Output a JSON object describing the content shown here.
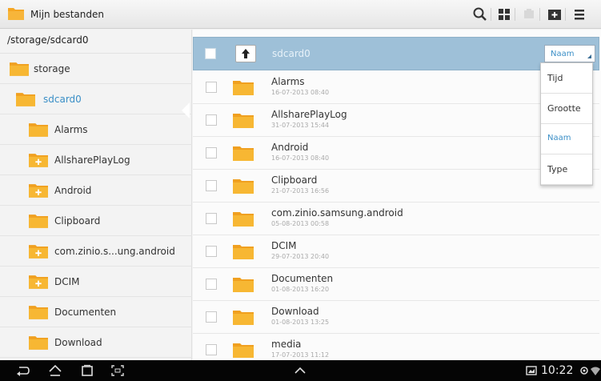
{
  "app": {
    "title": "Mijn bestanden"
  },
  "toolbar": {
    "icons": [
      "search-icon",
      "grid-view-icon",
      "disabled-icon",
      "new-folder-icon",
      "menu-icon"
    ]
  },
  "sidebar": {
    "path": "/storage/sdcard0",
    "items": [
      {
        "label": "storage",
        "level": 0,
        "plus": false
      },
      {
        "label": "sdcard0",
        "level": 1,
        "plus": false,
        "active": true
      },
      {
        "label": "Alarms",
        "level": 2,
        "plus": false
      },
      {
        "label": "AllsharePlayLog",
        "level": 2,
        "plus": true
      },
      {
        "label": "Android",
        "level": 2,
        "plus": true
      },
      {
        "label": "Clipboard",
        "level": 2,
        "plus": false
      },
      {
        "label": "com.zinio.s...ung.android",
        "level": 2,
        "plus": true
      },
      {
        "label": "DCIM",
        "level": 2,
        "plus": true
      },
      {
        "label": "Documenten",
        "level": 2,
        "plus": false
      },
      {
        "label": "Download",
        "level": 2,
        "plus": false
      }
    ]
  },
  "list": {
    "header_title": "sdcard0",
    "sort_value": "Naam",
    "rows": [
      {
        "name": "Alarms",
        "date": "16-07-2013 08:40"
      },
      {
        "name": "AllsharePlayLog",
        "date": "31-07-2013 15:44"
      },
      {
        "name": "Android",
        "date": "16-07-2013 08:40"
      },
      {
        "name": "Clipboard",
        "date": "21-07-2013 16:56"
      },
      {
        "name": "com.zinio.samsung.android",
        "date": "05-08-2013 00:58"
      },
      {
        "name": "DCIM",
        "date": "29-07-2013 20:40"
      },
      {
        "name": "Documenten",
        "date": "01-08-2013 16:20"
      },
      {
        "name": "Download",
        "date": "01-08-2013 13:25"
      },
      {
        "name": "media",
        "date": "17-07-2013 11:12"
      }
    ]
  },
  "sort_dropdown": {
    "options": [
      "Tijd",
      "Grootte",
      "Naam",
      "Type"
    ],
    "selected": "Naam"
  },
  "navbar": {
    "time": "10:22"
  },
  "colors": {
    "accent": "#3b8fc7",
    "header_bg": "#9ec0d8",
    "folder": "#f5a623"
  }
}
